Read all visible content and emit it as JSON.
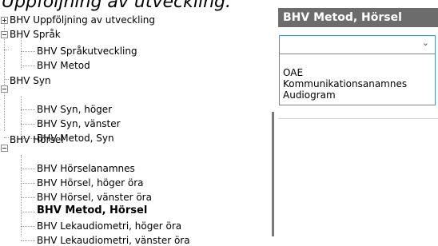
{
  "heading": "Uppföljning av utveckling.",
  "tree": {
    "nodes": [
      {
        "label": "BHV Uppföljning av utveckling",
        "expander": "plus"
      },
      {
        "label": "BHV Språk",
        "expander": "minus"
      },
      {
        "label": "BHV Språkutveckling"
      },
      {
        "label": "BHV Metod"
      },
      {
        "label": "BHV Syn",
        "expander": "minus"
      },
      {
        "label": "BHV Syn, höger"
      },
      {
        "label": "BHV Syn, vänster"
      },
      {
        "label": "BHV Metod, Syn"
      },
      {
        "label": "BHV Hörsel",
        "expander": "minus"
      },
      {
        "label": "BHV Hörselanamnes"
      },
      {
        "label": "BHV Hörsel, höger öra"
      },
      {
        "label": "BHV Hörsel, vänster öra"
      },
      {
        "label": "BHV Metod, Hörsel",
        "selected": true
      },
      {
        "label": "BHV Lekaudiometri, höger öra"
      },
      {
        "label": "BHV Lekaudiometri, vänster öra"
      }
    ]
  },
  "panel": {
    "title": "BHV Metod, Hörsel",
    "combo": {
      "value": "",
      "options": [
        "OAE",
        "Kommunikationsanamnes",
        "Audiogram"
      ]
    }
  }
}
